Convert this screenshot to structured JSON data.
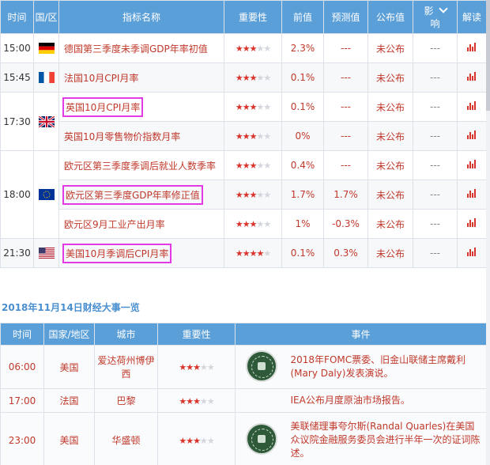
{
  "calendar": {
    "headers": [
      "时间",
      "国/区",
      "指标名称",
      "重要性",
      "前值",
      "预测值",
      "公布值",
      "影",
      "响",
      "解读"
    ],
    "groups": [
      {
        "time": "15:00",
        "flag": "de-flag-icon",
        "rows": [
          {
            "name": "德国第三季度未季调GDP年率初值",
            "stars": 3,
            "prev": "2.3%",
            "forecast": "---",
            "actual": "未公布",
            "impact": "---"
          }
        ]
      },
      {
        "time": "15:45",
        "flag": "fr-flag-icon",
        "rows": [
          {
            "name": "法国10月CPI月率",
            "stars": 3,
            "prev": "0.1%",
            "forecast": "---",
            "actual": "未公布",
            "impact": "---"
          }
        ]
      },
      {
        "time": "17:30",
        "flag": "uk-flag-icon",
        "rows": [
          {
            "name": "英国10月CPI月率",
            "stars": 3,
            "prev": "0.1%",
            "forecast": "---",
            "actual": "未公布",
            "impact": "---"
          },
          {
            "name": "英国10月零售物价指数月率",
            "stars": 3,
            "prev": "0%",
            "forecast": "---",
            "actual": "未公布",
            "impact": "---"
          }
        ]
      },
      {
        "time": "18:00",
        "flag": "eu-flag-icon",
        "rows": [
          {
            "name": "欧元区第三季度季调后就业人数季率",
            "stars": 3,
            "prev": "0.4%",
            "forecast": "---",
            "actual": "未公布",
            "impact": "---"
          },
          {
            "name": "欧元区第三季度GDP年率修正值",
            "stars": 3,
            "prev": "1.7%",
            "forecast": "1.7%",
            "actual": "未公布",
            "impact": "---"
          },
          {
            "name": "欧元区9月工业产出月率",
            "stars": 3,
            "prev": "1%",
            "forecast": "-0.3%",
            "actual": "未公布",
            "impact": "---"
          }
        ]
      },
      {
        "time": "21:30",
        "flag": "us-flag-icon",
        "rows": [
          {
            "name": "美国10月季调后CPI月率",
            "stars": 4,
            "prev": "0.1%",
            "forecast": "0.3%",
            "actual": "未公布",
            "impact": "---"
          }
        ]
      }
    ]
  },
  "events_section": {
    "title": "2018年11月14日财经大事一览",
    "headers": [
      "时间",
      "国家/地区",
      "城市",
      "重要性",
      "事件"
    ],
    "rows": [
      {
        "time": "06:00",
        "country": "美国",
        "city": "爱达荷州博伊西",
        "stars": 3,
        "event": "2018年FOMC票委、旧金山联储主席戴利(Mary Daly)发表演说。",
        "seal": true
      },
      {
        "time": "17:00",
        "country": "法国",
        "city": "巴黎",
        "stars": 3,
        "event": "IEA公布月度原油市场报告。",
        "seal": false
      },
      {
        "time": "23:00",
        "country": "美国",
        "city": "华盛顿",
        "stars": 3,
        "event": "美联储理事夸尔斯(Randal Quarles)在美国众议院金融服务委员会进行半年一次的证词陈述。",
        "seal": true
      }
    ]
  },
  "colors": {
    "header_bg": "#5b9fd8",
    "accent_red": "#c0392b",
    "highlight": "#e23be6",
    "link_blue": "#4a8fd0"
  }
}
